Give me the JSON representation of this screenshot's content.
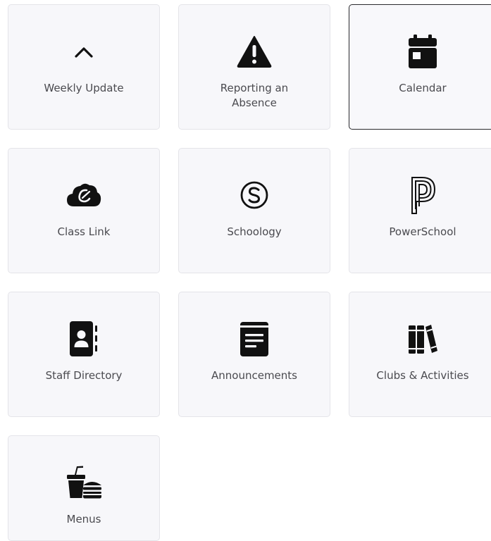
{
  "tiles": [
    {
      "label": "Weekly Update",
      "icon": "chevron-up-icon"
    },
    {
      "label": "Reporting an Absence",
      "icon": "warning-icon"
    },
    {
      "label": "Calendar",
      "icon": "calendar-icon",
      "selected": true
    },
    {
      "label": "Class Link",
      "icon": "classlink-cloud-icon"
    },
    {
      "label": "Schoology",
      "icon": "schoology-icon"
    },
    {
      "label": "PowerSchool",
      "icon": "powerschool-icon"
    },
    {
      "label": "Staff Directory",
      "icon": "contact-book-icon"
    },
    {
      "label": "Announcements",
      "icon": "notepad-icon"
    },
    {
      "label": "Clubs & Activities",
      "icon": "books-icon"
    },
    {
      "label": "Menus",
      "icon": "fast-food-icon"
    }
  ],
  "colors": {
    "tile_background": "#f7f7fa",
    "tile_border": "#e4e4e9",
    "selected_border": "#2a2a2e",
    "icon": "#111111",
    "label": "#4a4a4f"
  }
}
